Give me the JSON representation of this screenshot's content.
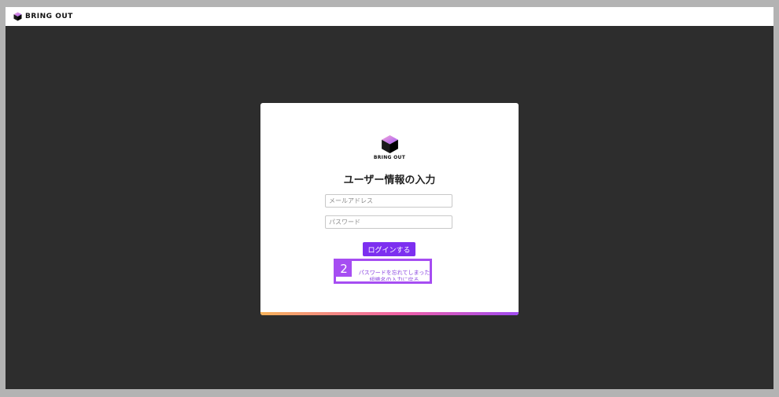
{
  "header": {
    "brand": "BRING OUT"
  },
  "card": {
    "logo_text": "BRING OUT",
    "title": "ユーザー情報の入力",
    "email_placeholder": "メールアドレス",
    "password_placeholder": "パスワード",
    "login_label": "ログインする",
    "forgot_link": "パスワードを忘れてしまった",
    "back_link": "組織名の入力に戻る",
    "annotation_badge": "2"
  },
  "colors": {
    "accent": "#7d2ff0",
    "highlight": "#a64df2",
    "link": "#8a44e0",
    "background": "#2d2d2d"
  }
}
